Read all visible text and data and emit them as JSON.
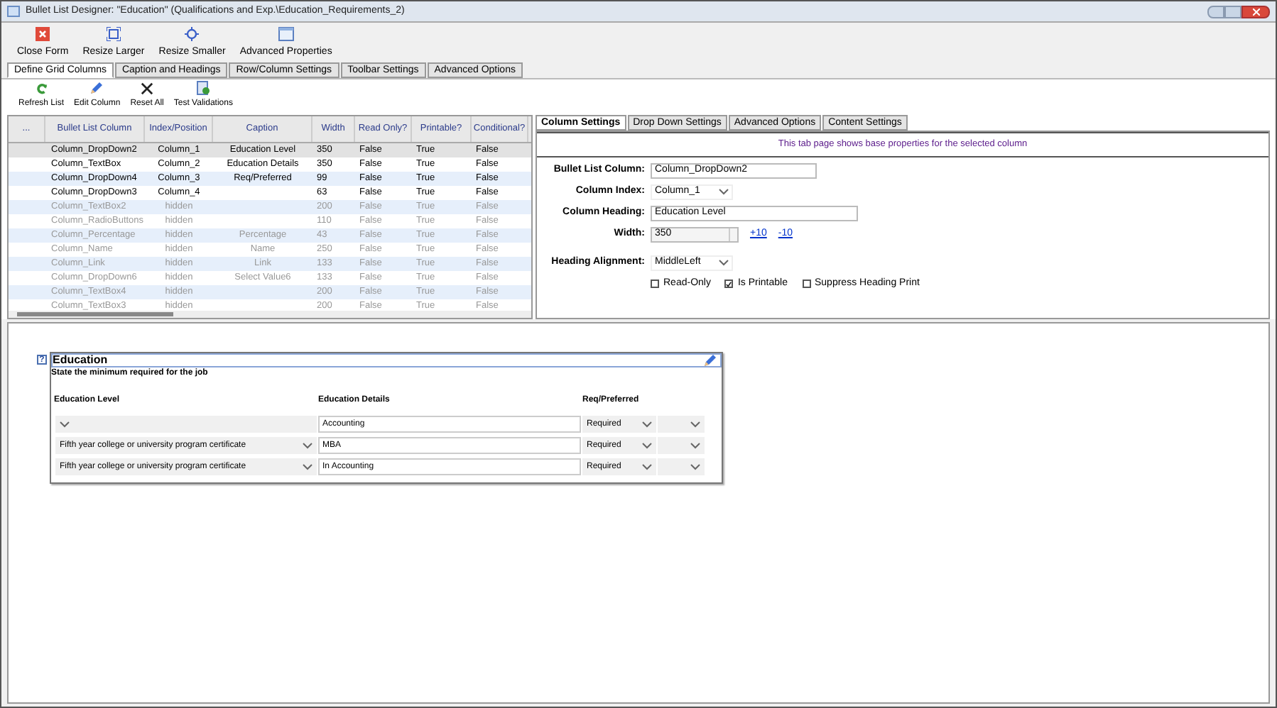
{
  "window": {
    "title": "Bullet List Designer: \"Education\" (Qualifications and Exp.\\Education_Requirements_2)"
  },
  "toolbar": [
    {
      "label": "Close Form",
      "kind": "close"
    },
    {
      "label": "Resize Larger",
      "kind": "larger"
    },
    {
      "label": "Resize Smaller",
      "kind": "smaller"
    },
    {
      "label": "Advanced Properties",
      "kind": "props"
    }
  ],
  "tabs": [
    {
      "label": "Define Grid Columns",
      "selected": true
    },
    {
      "label": "Caption and Headings",
      "selected": false
    },
    {
      "label": "Row/Column Settings",
      "selected": false
    },
    {
      "label": "Toolbar Settings",
      "selected": false
    },
    {
      "label": "Advanced Options",
      "selected": false
    }
  ],
  "subtoolbar": [
    {
      "label": "Refresh List",
      "kind": "refresh"
    },
    {
      "label": "Edit Column",
      "kind": "edit"
    },
    {
      "label": "Reset All",
      "kind": "reset"
    },
    {
      "label": "Test Validations",
      "kind": "test"
    }
  ],
  "grid": {
    "columns": [
      "...",
      "Bullet List Column",
      "Index/Position",
      "Caption",
      "Width",
      "Read Only?",
      "Printable?",
      "Conditional?"
    ],
    "rows": [
      {
        "cells": [
          "",
          "Column_DropDown2",
          "Column_1",
          "Education Level",
          "350",
          "False",
          "True",
          "False"
        ],
        "visible": true,
        "selected": true
      },
      {
        "cells": [
          "",
          "Column_TextBox",
          "Column_2",
          "Education Details",
          "350",
          "False",
          "True",
          "False"
        ],
        "visible": true,
        "selected": false
      },
      {
        "cells": [
          "",
          "Column_DropDown4",
          "Column_3",
          "Req/Preferred",
          "99",
          "False",
          "True",
          "False"
        ],
        "visible": true,
        "selected": false
      },
      {
        "cells": [
          "",
          "Column_DropDown3",
          "Column_4",
          "",
          "63",
          "False",
          "True",
          "False"
        ],
        "visible": true,
        "selected": false
      },
      {
        "cells": [
          "",
          "Column_TextBox2",
          "hidden",
          "",
          "200",
          "False",
          "True",
          "False"
        ],
        "visible": false,
        "selected": false
      },
      {
        "cells": [
          "",
          "Column_RadioButtons",
          "hidden",
          "",
          "110",
          "False",
          "True",
          "False"
        ],
        "visible": false,
        "selected": false
      },
      {
        "cells": [
          "",
          "Column_Percentage",
          "hidden",
          "Percentage",
          "43",
          "False",
          "True",
          "False"
        ],
        "visible": false,
        "selected": false
      },
      {
        "cells": [
          "",
          "Column_Name",
          "hidden",
          "Name",
          "250",
          "False",
          "True",
          "False"
        ],
        "visible": false,
        "selected": false
      },
      {
        "cells": [
          "",
          "Column_Link",
          "hidden",
          "Link",
          "133",
          "False",
          "True",
          "False"
        ],
        "visible": false,
        "selected": false
      },
      {
        "cells": [
          "",
          "Column_DropDown6",
          "hidden",
          "Select Value6",
          "133",
          "False",
          "True",
          "False"
        ],
        "visible": false,
        "selected": false
      },
      {
        "cells": [
          "",
          "Column_TextBox4",
          "hidden",
          "",
          "200",
          "False",
          "True",
          "False"
        ],
        "visible": false,
        "selected": false
      },
      {
        "cells": [
          "",
          "Column_TextBox3",
          "hidden",
          "",
          "200",
          "False",
          "True",
          "False"
        ],
        "visible": false,
        "selected": false
      }
    ]
  },
  "settings": {
    "tabs": [
      {
        "label": "Column Settings",
        "selected": true
      },
      {
        "label": "Drop Down Settings",
        "selected": false
      },
      {
        "label": "Advanced Options",
        "selected": false
      },
      {
        "label": "Content Settings",
        "selected": false
      }
    ],
    "info": "This tab page shows base properties for the selected column",
    "bullet_list_column": {
      "label": "Bullet List Column:",
      "value": "Column_DropDown2"
    },
    "column_index": {
      "label": "Column Index:",
      "value": "Column_1"
    },
    "column_heading": {
      "label": "Column Heading:",
      "value": "Education Level"
    },
    "width": {
      "label": "Width:",
      "value": "350",
      "plus": "+10",
      "minus": "-10"
    },
    "heading_alignment": {
      "label": "Heading Alignment:",
      "value": "MiddleLeft"
    },
    "checkboxes": [
      {
        "label": "Read-Only",
        "checked": false
      },
      {
        "label": "Is Printable",
        "checked": true
      },
      {
        "label": "Suppress Heading Print",
        "checked": false
      }
    ]
  },
  "preview": {
    "help": "?",
    "title": "Education",
    "subtitle": "State the minimum required for the job",
    "headers": [
      "Education Level",
      "Education Details",
      "Req/Preferred"
    ],
    "rows": [
      [
        "",
        "Accounting",
        "Required",
        ""
      ],
      [
        "Fifth year college or university program certificate",
        "MBA",
        "Required",
        ""
      ],
      [
        "Fifth year college or university program certificate",
        "In Accounting",
        "Required",
        ""
      ]
    ]
  }
}
